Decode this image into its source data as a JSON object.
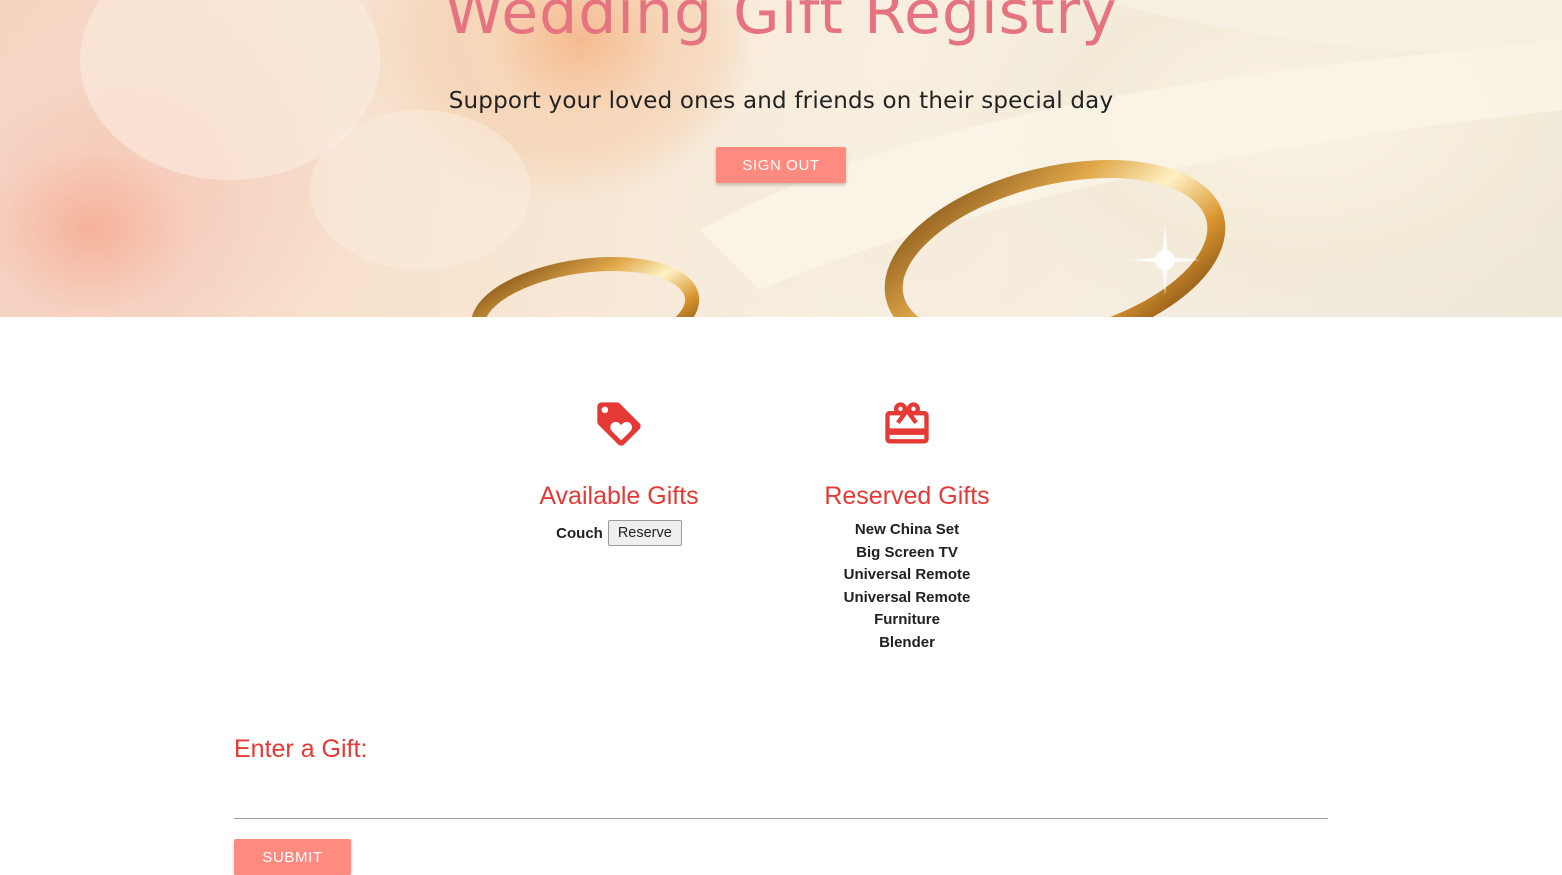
{
  "header": {
    "title": "Wedding Gift Registry",
    "subtitle": "Support your loved ones and friends on their special day",
    "signout_label": "SIGN OUT"
  },
  "available": {
    "icon": "heart-tag-icon",
    "heading": "Available Gifts",
    "items": [
      {
        "name": "Couch",
        "action_label": "Reserve"
      }
    ]
  },
  "reserved": {
    "icon": "gift-card-icon",
    "heading": "Reserved Gifts",
    "items": [
      "New China Set",
      "Big Screen TV",
      "Universal Remote",
      "Universal Remote",
      "Furniture",
      "Blender"
    ]
  },
  "form": {
    "label": "Enter a Gift:",
    "input_value": "",
    "submit_label": "SUBMIT"
  },
  "colors": {
    "accent_red": "#e53935",
    "title_pink": "#e57380",
    "button_salmon": "#ff8a80"
  }
}
